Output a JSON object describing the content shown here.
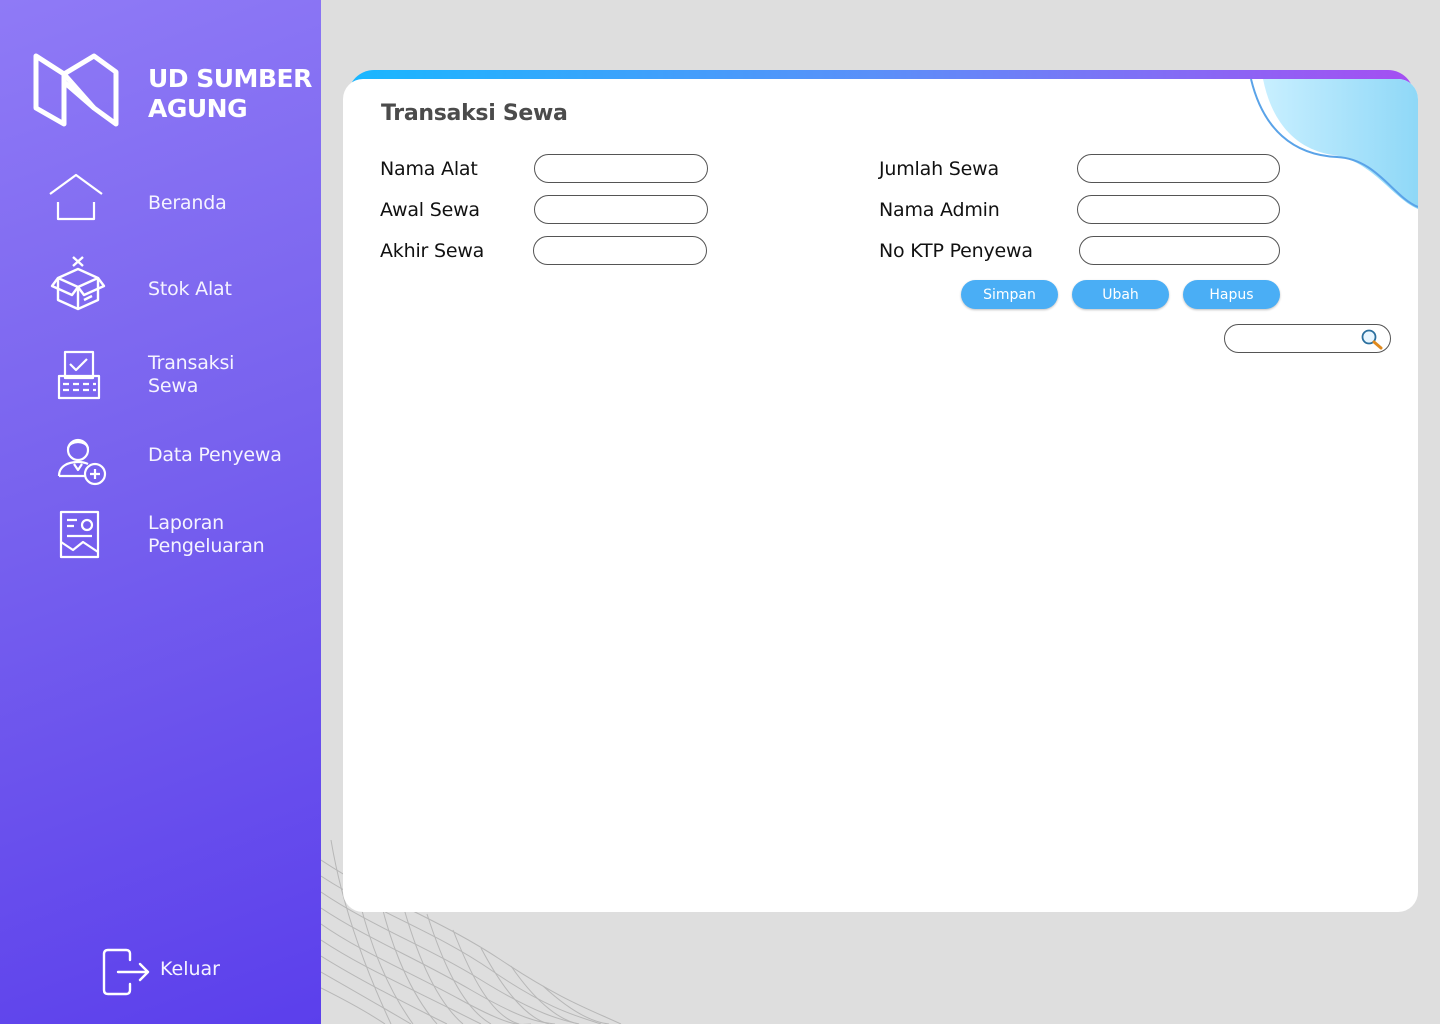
{
  "brand": {
    "name": "UD SUMBER\nAGUNG",
    "logo_icon": "brand-logo-icon"
  },
  "sidebar": {
    "items": [
      {
        "label": "Beranda",
        "icon": "home-icon"
      },
      {
        "label": "Stok Alat",
        "icon": "box-icon"
      },
      {
        "label": "Transaksi\nSewa",
        "icon": "receipt-icon"
      },
      {
        "label": "Data Penyewa",
        "icon": "user-add-icon"
      },
      {
        "label": "Laporan\nPengeluaran",
        "icon": "report-icon"
      }
    ],
    "logout": {
      "label": "Keluar",
      "icon": "logout-icon"
    }
  },
  "page": {
    "title": "Transaksi Sewa",
    "fields_left": [
      {
        "label": "Nama Alat",
        "value": ""
      },
      {
        "label": "Awal Sewa",
        "value": ""
      },
      {
        "label": "Akhir Sewa",
        "value": ""
      }
    ],
    "fields_right": [
      {
        "label": "Jumlah Sewa",
        "value": ""
      },
      {
        "label": "Nama Admin",
        "value": ""
      },
      {
        "label": "No KTP Penyewa",
        "value": ""
      }
    ],
    "buttons": {
      "save": "Simpan",
      "edit": "Ubah",
      "delete": "Hapus"
    },
    "search": {
      "value": "",
      "icon": "search-icon"
    }
  },
  "colors": {
    "sidebar_top": "#8f7af6",
    "sidebar_bottom": "#5b3fec",
    "button": "#4aaef5",
    "card_bar_start": "#19b7ff",
    "card_bar_end": "#a54ef2",
    "background": "#dedede"
  }
}
